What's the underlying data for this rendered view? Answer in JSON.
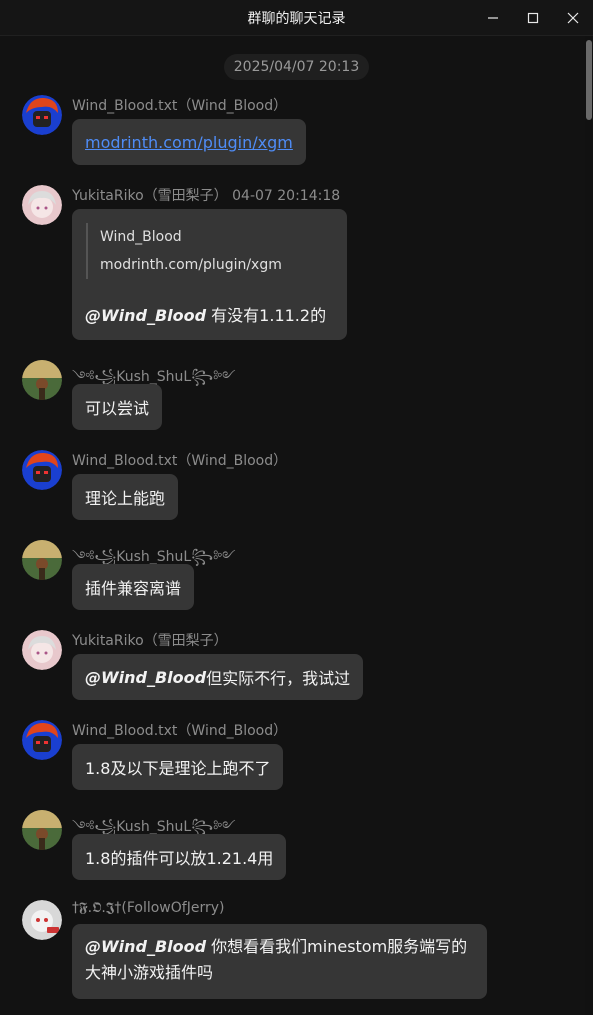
{
  "window": {
    "title": "群聊的聊天记录"
  },
  "date_divider": "2025/04/07 20:13",
  "messages": [
    {
      "sender": "Wind_Blood.txt（Wind_Blood）",
      "text": "modrinth.com/plugin/xgm"
    },
    {
      "sender": "YukitaRiko（雪田梨子）  04-07 20:14:18",
      "quote_author": "Wind_Blood",
      "quote_text": "modrinth.com/plugin/xgm",
      "mention": "@Wind_Blood",
      "text": " 有没有1.11.2的"
    },
    {
      "sender": "༺꧁Kush_ShuL꧂༻",
      "text": "可以尝试"
    },
    {
      "sender": "Wind_Blood.txt（Wind_Blood）",
      "text": "理论上能跑"
    },
    {
      "sender": "༺꧁Kush_ShuL꧂༻",
      "text": "插件兼容离谱"
    },
    {
      "sender": "YukitaRiko（雪田梨子）",
      "mention": "@Wind_Blood",
      "text": " 但实际不行，我试过"
    },
    {
      "sender": "Wind_Blood.txt（Wind_Blood）",
      "text": "1.8及以下是理论上跑不了"
    },
    {
      "sender": "༺꧁Kush_ShuL꧂༻",
      "text": "1.8的插件可以放1.21.4用"
    },
    {
      "sender": "†𝕱.𝕺.𝕵†(FollowOfJerry)",
      "mention": "@Wind_Blood",
      "text": " 你想看看我们minestom服务端写的大神小游戏插件吗"
    }
  ],
  "icons": {
    "minimize": "minimize-icon",
    "maximize": "maximize-icon",
    "close": "close-icon"
  },
  "colors": {
    "background": "#121212",
    "bubble": "#363636",
    "link": "#4f8cf5",
    "sender": "#8c8c8c"
  }
}
